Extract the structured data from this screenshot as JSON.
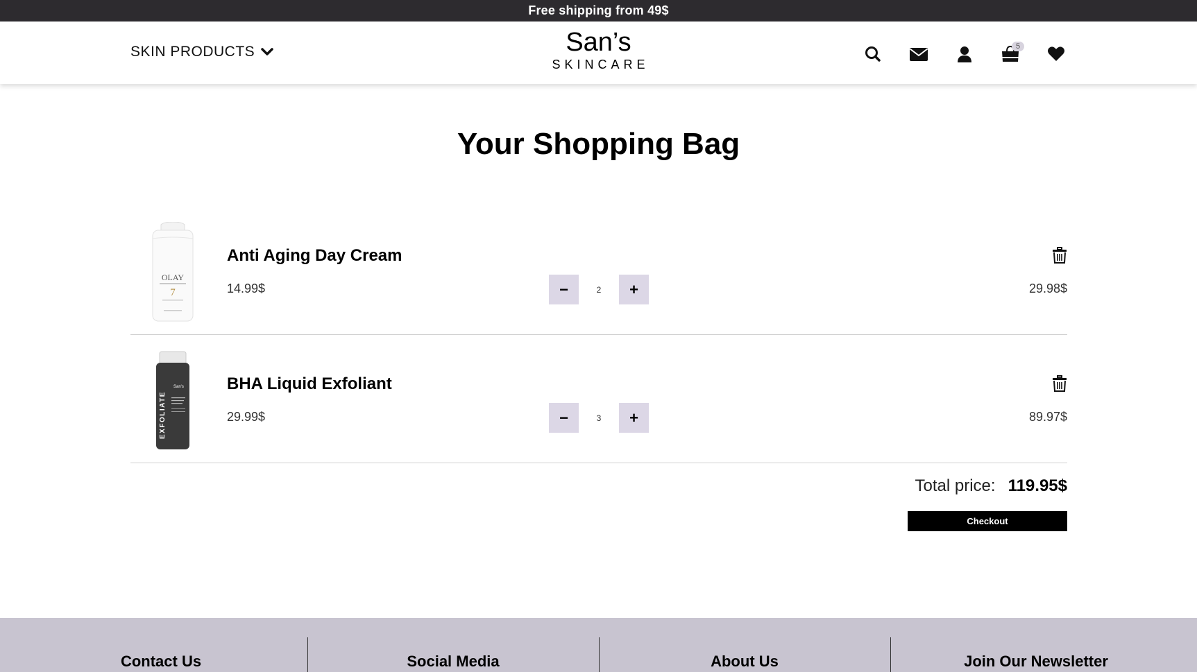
{
  "topbar": {
    "text": "Free shipping from 49$"
  },
  "header": {
    "menu_label": "SKIN PRODUCTS",
    "logo_main": "San’s",
    "logo_sub": "SKINCARE",
    "icons": [
      "search-icon",
      "envelope-icon",
      "user-icon",
      "shopping-bag-icon",
      "heart-icon"
    ],
    "cart_count": "5"
  },
  "main": {
    "title": "Your Shopping Bag",
    "items": [
      {
        "name": "Anti Aging Day Cream",
        "unit_price": "14.99$",
        "quantity": "2",
        "line_total": "29.98$",
        "image": "day-cream-product-image"
      },
      {
        "name": "BHA Liquid Exfoliant",
        "unit_price": "29.99$",
        "quantity": "3",
        "line_total": "89.97$",
        "image": "exfoliant-product-image"
      }
    ],
    "minus_label": "−",
    "plus_label": "+",
    "total_label": "Total price:",
    "total_value": "119.95$",
    "checkout_label": "Checkout"
  },
  "footer": {
    "columns": [
      "Contact Us",
      "Social Media",
      "About Us",
      "Join Our Newsletter"
    ]
  },
  "colors": {
    "topbar": "#2d2b2f",
    "qty_button": "#dcd7e6",
    "footer": "#c8c4d0",
    "checkout": "#000000"
  }
}
